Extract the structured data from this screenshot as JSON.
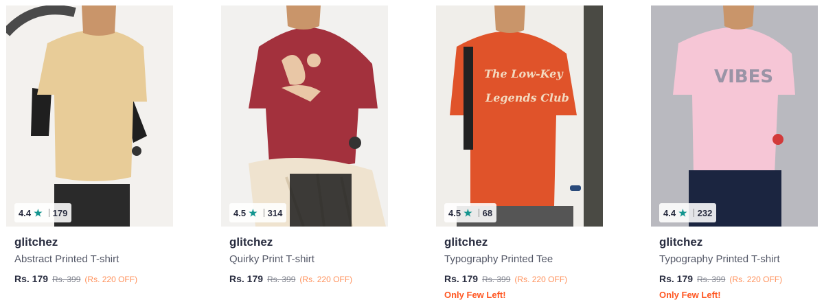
{
  "products": [
    {
      "rating": "4.4",
      "rating_count": "179",
      "brand": "glitchez",
      "title": "Abstract Printed T-shirt",
      "price": "Rs. 179",
      "mrp": "Rs. 399",
      "discount": "(Rs. 220 OFF)",
      "tee_color": "#e8cc98",
      "bg_color": "#f3f1ee",
      "low_stock": ""
    },
    {
      "rating": "4.5",
      "rating_count": "314",
      "brand": "glitchez",
      "title": "Quirky Print T-shirt",
      "price": "Rs. 179",
      "mrp": "Rs. 399",
      "discount": "(Rs. 220 OFF)",
      "tee_color": "#a3313d",
      "bg_color": "#f2f1ef",
      "low_stock": ""
    },
    {
      "rating": "4.5",
      "rating_count": "68",
      "brand": "glitchez",
      "title": "Typography Printed Tee",
      "price": "Rs. 179",
      "mrp": "Rs. 399",
      "discount": "(Rs. 220 OFF)",
      "tee_color": "#e0532a",
      "bg_color": "#f0eeea",
      "low_stock": "Only Few Left!"
    },
    {
      "rating": "4.4",
      "rating_count": "232",
      "brand": "glitchez",
      "title": "Typography Printed T-shirt",
      "price": "Rs. 179",
      "mrp": "Rs. 399",
      "discount": "(Rs. 220 OFF)",
      "tee_color": "#f6c6d6",
      "bg_color": "#b9b9bf",
      "low_stock": "Only Few Left!"
    }
  ],
  "print_texts": [
    "The Low-Key Legends Club",
    "VIBES"
  ],
  "colors": {
    "accent_star": "#14958f",
    "discount": "#ff905a",
    "low_stock": "#ff5722"
  },
  "icons": [
    "star-icon"
  ]
}
